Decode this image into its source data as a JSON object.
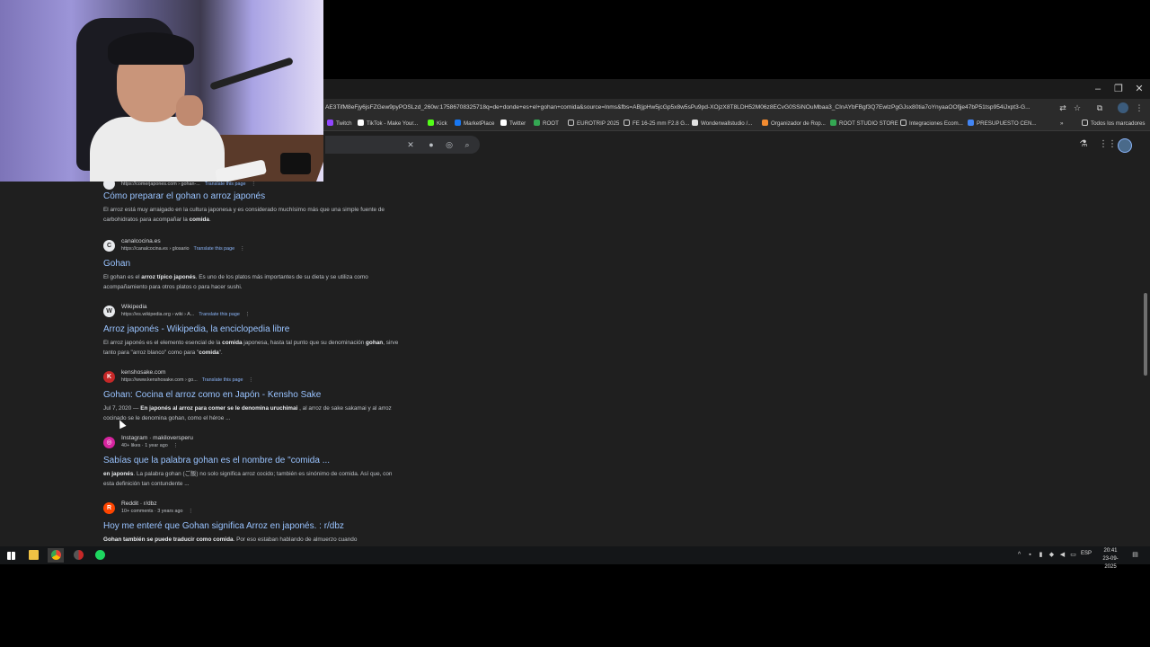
{
  "browser": {
    "url": "AE3TifM8eFjy6jsFZGew9pyPOSLzd_260w:17586708325718q=de+donde+es+el+gohan+comida&source=lnms&fbs=AB|jpHw5jcGp5x8w5sPu9pd-XOjzX8T8LDH52M06z8ECvG0SSiNOuMbaa3_CInAYbFBgf3Q7EwlzPgGJsx80tia7oYnyaaOOfjje47bP51tsp954iJxpt3-G...",
    "window_controls": {
      "minimize": "–",
      "maximize": "❐",
      "close": "✕"
    }
  },
  "bookmarks": [
    {
      "label": "Twitch",
      "color": "#9146ff"
    },
    {
      "label": "TikTok - Make Your...",
      "color": "#ffffff"
    },
    {
      "label": "Kick",
      "color": "#53fc18"
    },
    {
      "label": "MarketPlace",
      "color": "#1877f2"
    },
    {
      "label": "Twitter",
      "color": "#ffffff"
    },
    {
      "label": "ROOT",
      "color": "#34a853"
    },
    {
      "label": "EUROTRIP 2025",
      "color": "#c8c8c8"
    },
    {
      "label": "FE 16-25 mm F2.8 G...",
      "color": "#c8c8c8"
    },
    {
      "label": "Wonderwallstudio /...",
      "color": "#e0e0e0"
    },
    {
      "label": "Organizador de Rop...",
      "color": "#f28b30"
    },
    {
      "label": "ROOT STUDIO STORE",
      "color": "#34a853"
    },
    {
      "label": "Integraciones Ecom...",
      "color": "#c8c8c8"
    },
    {
      "label": "PRESUPUESTO CEN...",
      "color": "#4285f4"
    }
  ],
  "all_bookmarks_label": "Todos los marcadores",
  "results": [
    {
      "favicon": "",
      "site": "",
      "crumb": "https://comerjapones.com › gohan-...",
      "translate": "Translate this page",
      "title": "Cómo preparar el gohan o arroz japonés",
      "snippet_html": "El arroz está muy arraigado en la cultura japonesa y es considerado muchísimo más que una simple fuente de carbohidratos para acompañar la <b>comida</b>."
    },
    {
      "favicon": "C",
      "site": "canalcocina.es",
      "crumb": "https://canalcocina.es › glosario",
      "translate": "Translate this page",
      "title": "Gohan",
      "snippet_html": "El gohan es el <b>arroz típico japonés</b>. Es uno de los platos más importantes de su dieta y se utiliza como acompañamiento para otros platos o para hacer sushi."
    },
    {
      "favicon": "W",
      "site": "Wikipedia",
      "crumb": "https://es.wikipedia.org › wiki › A...",
      "translate": "Translate this page",
      "title": "Arroz japonés - Wikipedia, la enciclopedia libre",
      "snippet_html": "El arroz japonés es el elemento esencial de la <b>comida</b> japonesa, hasta tal punto que su denominación <b>gohan</b>, sirve tanto para \"arroz blanco\" como para \"<b>comida</b>\"."
    },
    {
      "favicon": "K",
      "site": "kenshosake.com",
      "crumb": "https://www.kenshosake.com › go...",
      "translate": "Translate this page",
      "title": "Gohan: Cocina el arroz como en Japón - Kensho Sake",
      "snippet_html": "Jul 7, 2020 — <b>En japonés al arroz para comer se le denomina uruchimai</b> , al arroz de sake sakamai y al arroz cocinado se le denomina gohan, como el héroe ..."
    },
    {
      "favicon": "◎",
      "site": "Instagram · makiloversperu",
      "crumb": "40+ likes · 1 year ago",
      "translate": "",
      "title": "Sabías que la palabra gohan es el nombre de \"comida ...",
      "snippet_html": "<b>en japonés</b>. La palabra gohan (ご飯) no solo significa arroz cocido; también es sinónimo de comida. Así que, con esta definición tan contundente ..."
    },
    {
      "favicon": "R",
      "site": "Reddit · r/dbz",
      "crumb": "10+ comments · 3 years ago",
      "translate": "",
      "title": "Hoy me enteré que Gohan significa Arroz en japonés. : r/dbz",
      "snippet_html": "<b>Gohan también se puede traducir como comida</b>. Por eso estaban hablando de almuerzo cuando"
    }
  ],
  "taskbar": {
    "language": "ESP",
    "time": "20:41",
    "date": "23-09-2025"
  }
}
